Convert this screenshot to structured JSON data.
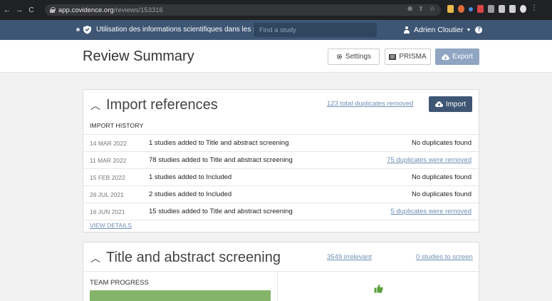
{
  "browser": {
    "url_host": "app.covidence.org",
    "url_path": "/reviews/153316",
    "nav": {
      "back": "←",
      "forward": "→",
      "reload": "C"
    }
  },
  "app_header": {
    "review_title": "Utilisation des informations scientifiques dans les pa...",
    "search_placeholder": "Find a study",
    "user_name": "Adrien Cloutier"
  },
  "page": {
    "title": "Review Summary",
    "settings_label": "Settings",
    "prisma_label": "PRISMA",
    "export_label": "Export"
  },
  "import_card": {
    "title": "Import references",
    "duplicates_total": "123 total duplicates removed",
    "import_label": "Import",
    "history_label": "IMPORT HISTORY",
    "rows": [
      {
        "date": "14 MAR 2022",
        "count": "1 studies added to ",
        "stage": "Title and abstract screening",
        "result": "No duplicates found",
        "result_link": false
      },
      {
        "date": "11 MAR 2022",
        "count": "78 studies added to ",
        "stage": "Title and abstract screening",
        "result": "75 duplicates were removed",
        "result_link": true
      },
      {
        "date": "15 FEB 2022",
        "count": "1 studies added to ",
        "stage": "Included",
        "result": "No duplicates found",
        "result_link": false
      },
      {
        "date": "26 JUL 2021",
        "count": "2 studies added to ",
        "stage": "Included",
        "result": "No duplicates found",
        "result_link": false
      },
      {
        "date": "16 JUN 2021",
        "count": "15 studies added to ",
        "stage": "Title and abstract screening",
        "result": "5 duplicates were removed",
        "result_link": true
      }
    ],
    "view_details": "VIEW DETAILS"
  },
  "screening_card": {
    "title": "Title and abstract screening",
    "irrelevant": "3549 irrelevant",
    "to_screen": "0 studies to screen",
    "team_progress_label": "TEAM PROGRESS"
  },
  "colors": {
    "header_bg": "#3e5674",
    "accent_link": "#6f8fb4",
    "export_bg": "#8fa5c2",
    "progress_green": "#84b36a",
    "thumb_green": "#5aa03c"
  }
}
